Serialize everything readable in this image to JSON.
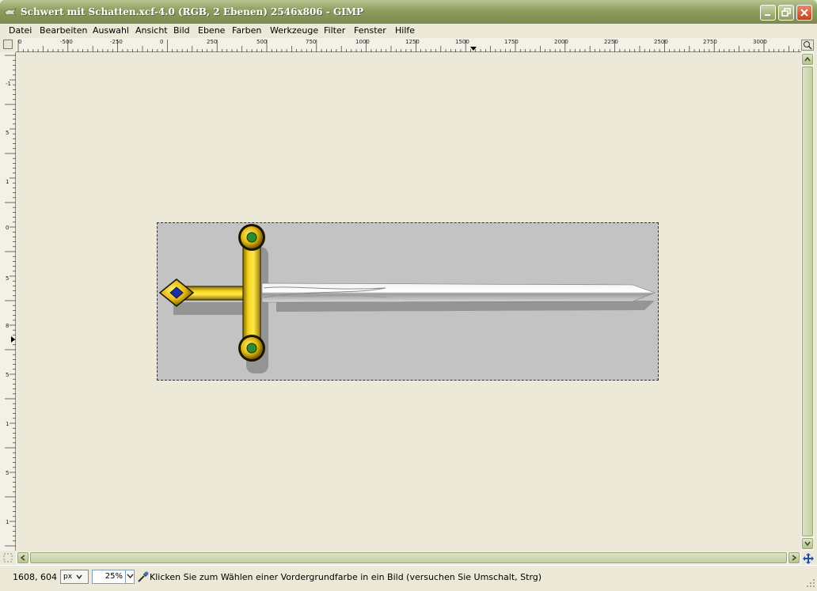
{
  "window": {
    "title": "Schwert mit Schatten.xcf-4.0 (RGB, 2 Ebenen) 2546x806 - GIMP"
  },
  "menu": [
    "Datei",
    "Bearbeiten",
    "Auswahl",
    "Ansicht",
    "Bild",
    "Ebene",
    "Farben",
    "Werkzeuge",
    "Filter",
    "Fenster",
    "Hilfe"
  ],
  "ruler": {
    "horizontal_labels": [
      "0",
      "-500",
      "-250",
      "0",
      "250",
      "500",
      "750",
      "1000",
      "1250",
      "1500",
      "1750",
      "2000",
      "2250",
      "2500",
      "2750",
      "3000"
    ],
    "vertical_labels": [
      "-1",
      "5",
      "1",
      "0",
      "5",
      "8",
      "5",
      "1",
      "5",
      "1",
      "5"
    ]
  },
  "status": {
    "coords": "1608, 604",
    "unit": "px",
    "zoom": "25%",
    "message": "Klicken Sie zum Wählen einer Vordergrundfarbe in ein Bild (versuchen Sie Umschalt, Strg)"
  },
  "icons": {
    "window_icon": "gimp-wilber-icon",
    "minimize": "minimize-icon",
    "maximize": "restore-icon",
    "close": "close-icon",
    "navigate": "navigate-icon",
    "picker": "color-picker-icon"
  },
  "colors": {
    "titlebar": "#8E9C5F",
    "canvas_bg": "#ECE9D8",
    "image_bg": "#C3C3C3",
    "hilt_gold": "#E8C619",
    "gem_blue": "#1A2FA8",
    "gem_green": "#2E8B2E"
  }
}
